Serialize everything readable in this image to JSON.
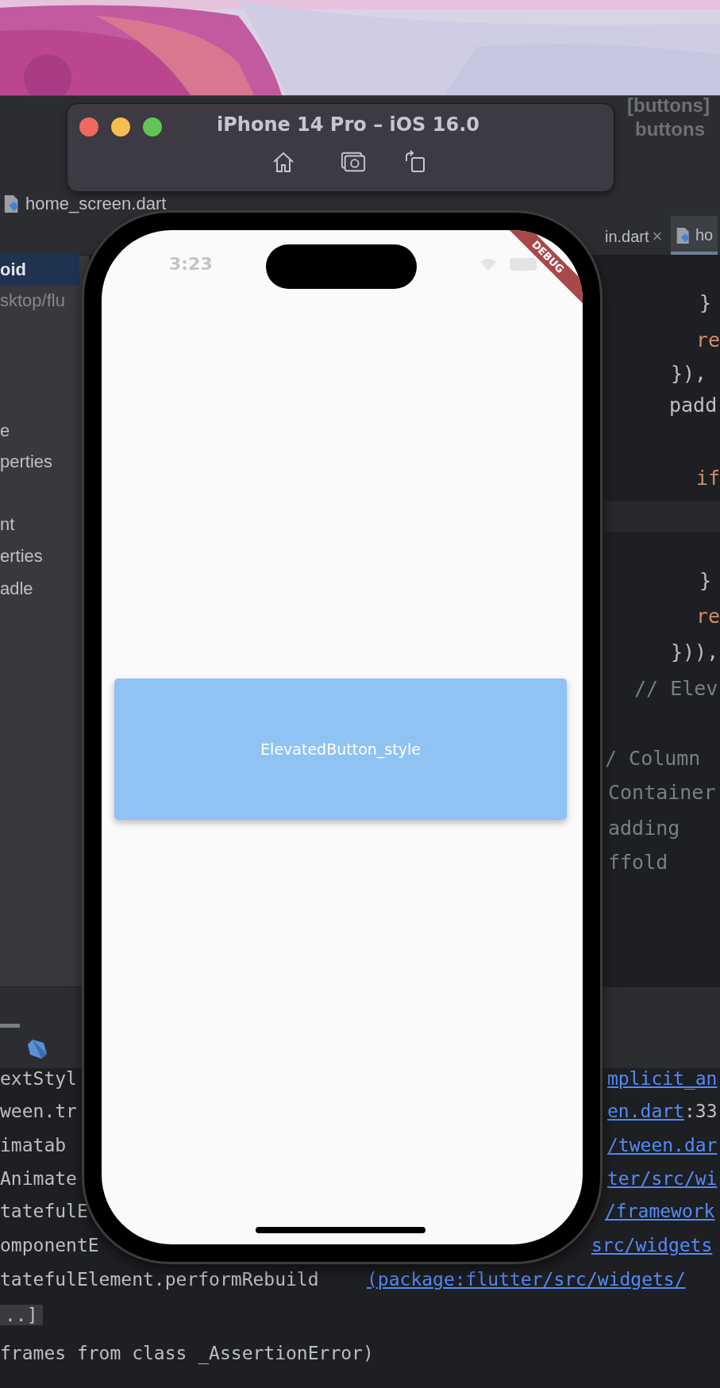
{
  "ide": {
    "title_fragment": "[buttons]",
    "project_name": "buttons",
    "breadcrumb_file": "home_screen.dart",
    "editor_tabs": [
      {
        "label": "in.dart",
        "selected": false,
        "close_glyph": "×"
      },
      {
        "label": "ho",
        "selected": true
      }
    ],
    "project_panel": [
      {
        "text": "oid",
        "selected": true,
        "kind": "name"
      },
      {
        "text": "sktop/flu",
        "selected": false,
        "kind": "path"
      },
      {
        "text": "e",
        "selected": false,
        "kind": "name"
      },
      {
        "text": "perties",
        "selected": false,
        "kind": "name"
      },
      {
        "text": "nt",
        "selected": false,
        "kind": "name"
      },
      {
        "text": "erties",
        "selected": false,
        "kind": "name"
      },
      {
        "text": "adle",
        "selected": false,
        "kind": "name"
      }
    ],
    "code_lines": [
      {
        "text": "}",
        "kind": "plain"
      },
      {
        "text": "re",
        "kind": "keyword"
      },
      {
        "text": "}),",
        "kind": "plain"
      },
      {
        "text": "padd",
        "kind": "plain"
      },
      {
        "text": "if",
        "kind": "keyword"
      },
      {
        "text": "}",
        "kind": "plain"
      },
      {
        "text": "re",
        "kind": "keyword"
      },
      {
        "text": "})),",
        "kind": "plain"
      },
      {
        "text": "// Elev",
        "kind": "comment"
      },
      {
        "text": "/ Column",
        "kind": "comment"
      },
      {
        "text": "Container",
        "kind": "comment"
      },
      {
        "text": "adding",
        "kind": "comment"
      },
      {
        "text": "ffold",
        "kind": "comment"
      }
    ],
    "console_lines": [
      {
        "text": "extStyl",
        "link": "mplicit_an"
      },
      {
        "text": "ween.tr",
        "link": "en.dart",
        "suffix": ":33"
      },
      {
        "text": "imatab",
        "link": "/tween.dar"
      },
      {
        "text": "Animate",
        "link": "ter/src/wi"
      },
      {
        "text": "tatefulE",
        "link": "/framework"
      },
      {
        "text": "omponentE",
        "link": "src/widgets"
      },
      {
        "text": "tatefulElement.performRebuild",
        "link": "(package:flutter/src/widgets/"
      },
      {
        "text": "..]",
        "kind": "folded"
      },
      {
        "text": "frames from class _AssertionError)",
        "kind": "plain"
      }
    ]
  },
  "simulator": {
    "title": "iPhone 14 Pro – iOS 16.0",
    "status_time": "3:23",
    "debug_banner": "DEBUG",
    "button_label": "ElevatedButton_style"
  }
}
